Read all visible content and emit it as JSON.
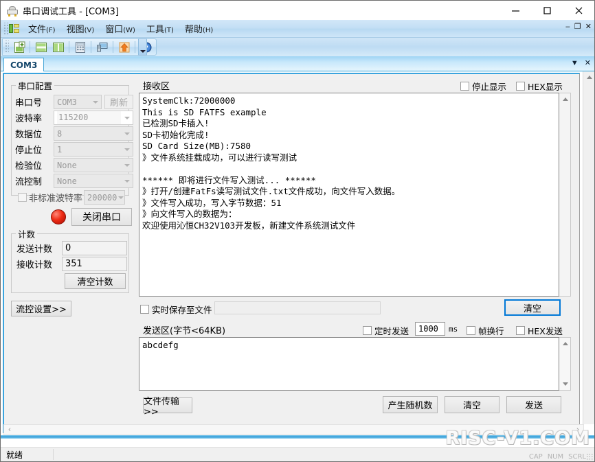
{
  "window": {
    "title": "串口调试工具 - [COM3]",
    "app_icon": "serial-plug-icon",
    "minimize": "minimize-icon",
    "maximize": "maximize-icon",
    "close": "close-icon"
  },
  "menubar": {
    "items": [
      {
        "label": "文件",
        "mnemonic": "(F)"
      },
      {
        "label": "视图",
        "mnemonic": "(V)"
      },
      {
        "label": "窗口",
        "mnemonic": "(W)"
      },
      {
        "label": "工具",
        "mnemonic": "(T)"
      },
      {
        "label": "帮助",
        "mnemonic": "(H)"
      }
    ],
    "mdi_minimize": "‒",
    "mdi_restore": "❐",
    "mdi_close": "✕"
  },
  "toolbar": {
    "buttons": [
      {
        "name": "new-document-icon"
      },
      {
        "name": "horizontal-tile-icon"
      },
      {
        "name": "vertical-tile-icon"
      },
      {
        "name": "calculator-icon"
      },
      {
        "name": "computer-icon"
      },
      {
        "name": "upload-arrow-icon"
      },
      {
        "name": "help-icon"
      }
    ],
    "overflow": "toolbar-overflow-icon"
  },
  "tabs": {
    "items": [
      {
        "label": "COM3",
        "active": true
      }
    ],
    "dropdown": "▼",
    "close": "✕"
  },
  "serial_config": {
    "group_title": "串口配置",
    "fields": [
      {
        "label": "串口号",
        "value": "COM3",
        "type": "combo",
        "editable": false
      },
      {
        "label": "波特率",
        "value": "115200",
        "type": "combo",
        "editable": true
      },
      {
        "label": "数据位",
        "value": "8",
        "type": "combo",
        "editable": false
      },
      {
        "label": "停止位",
        "value": "1",
        "type": "combo",
        "editable": false
      },
      {
        "label": "检验位",
        "value": "None",
        "type": "combo",
        "editable": false
      },
      {
        "label": "流控制",
        "value": "None",
        "type": "combo",
        "editable": false
      }
    ],
    "refresh_button": "刷新",
    "nonstandard": {
      "label": "非标准波特率",
      "checked": false,
      "value": "200000"
    }
  },
  "port_control": {
    "led": "red-indicator",
    "toggle_button": "关闭串口"
  },
  "counters": {
    "group_title": "计数",
    "send_label": "发送计数",
    "send_value": "0",
    "recv_label": "接收计数",
    "recv_value": "351",
    "clear_button": "清空计数"
  },
  "flow_control": {
    "button": "流控设置>>"
  },
  "receive": {
    "title": "接收区",
    "stop_display": {
      "label": "停止显示",
      "checked": false
    },
    "hex_display": {
      "label": "HEX显示",
      "checked": false
    },
    "content": "SystemClk:72000000\nThis is SD FATFS example\n已检测SD卡插入!\nSD卡初始化完成!\nSD Card Size(MB):7580\n》文件系统挂载成功，可以进行读写测试\n\n****** 即将进行文件写入测试... ******\n》打开/创建FatFs读写测试文件.txt文件成功，向文件写入数据。\n》文件写入成功，写入字节数据：51\n》向文件写入的数据为：\n欢迎使用沁恒CH32V103开发板，新建文件系统测试文件",
    "save_to_file": {
      "label": "实时保存至文件",
      "checked": false,
      "path": ""
    },
    "clear_button": "清空"
  },
  "send": {
    "title": "发送区(字节<64KB)",
    "timed_send": {
      "label": "定时发送",
      "checked": false
    },
    "interval_value": "1000",
    "interval_unit": "ms",
    "frame_newline": {
      "label": "帧换行",
      "checked": false
    },
    "hex_send": {
      "label": "HEX发送",
      "checked": false
    },
    "content": "abcdefg",
    "file_transfer_button": "文件传输>>",
    "random_button": "产生随机数",
    "clear_button": "清空",
    "send_button": "发送"
  },
  "statusbar": {
    "text": "就绪",
    "indicators": [
      "CAP",
      "NUM",
      "SCRL"
    ]
  },
  "watermark": {
    "text": "RISC-V1.COM"
  }
}
